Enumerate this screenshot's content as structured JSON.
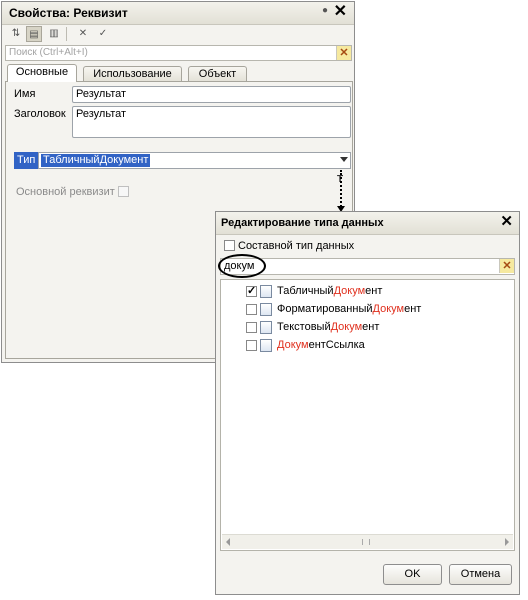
{
  "properties": {
    "title": "Свойства: Реквизит",
    "search_placeholder": "Поиск (Ctrl+Alt+I)",
    "tabs": [
      "Основные",
      "Использование",
      "Объект"
    ],
    "name_label": "Имя",
    "name_value": "Результат",
    "caption_label": "Заголовок",
    "caption_value": "Результат",
    "type_label": "Тип",
    "type_value": "ТабличныйДокумент",
    "type_button": "T",
    "main_attribute_label": "Основной реквизит"
  },
  "dialog": {
    "title": "Редактирование типа данных",
    "composite_label": "Составной тип данных",
    "search_value": "докум",
    "types": [
      {
        "pre": "Табличный",
        "hl": "Докум",
        "post": "ент",
        "checked": true,
        "icon": "spreadsheet-icon"
      },
      {
        "pre": "Форматированный",
        "hl": "Докум",
        "post": "ент",
        "checked": false,
        "icon": "formatted-document-icon"
      },
      {
        "pre": "Текстовый",
        "hl": "Докум",
        "post": "ент",
        "checked": false,
        "icon": "text-document-icon"
      },
      {
        "pre": "",
        "hl": "Докум",
        "post": "ентСсылка",
        "checked": false,
        "icon": "document-ref-icon"
      }
    ],
    "ok": "OK",
    "cancel": "Отмена"
  },
  "colors": {
    "selection": "#3163c5",
    "match_highlight": "#e0301e"
  }
}
